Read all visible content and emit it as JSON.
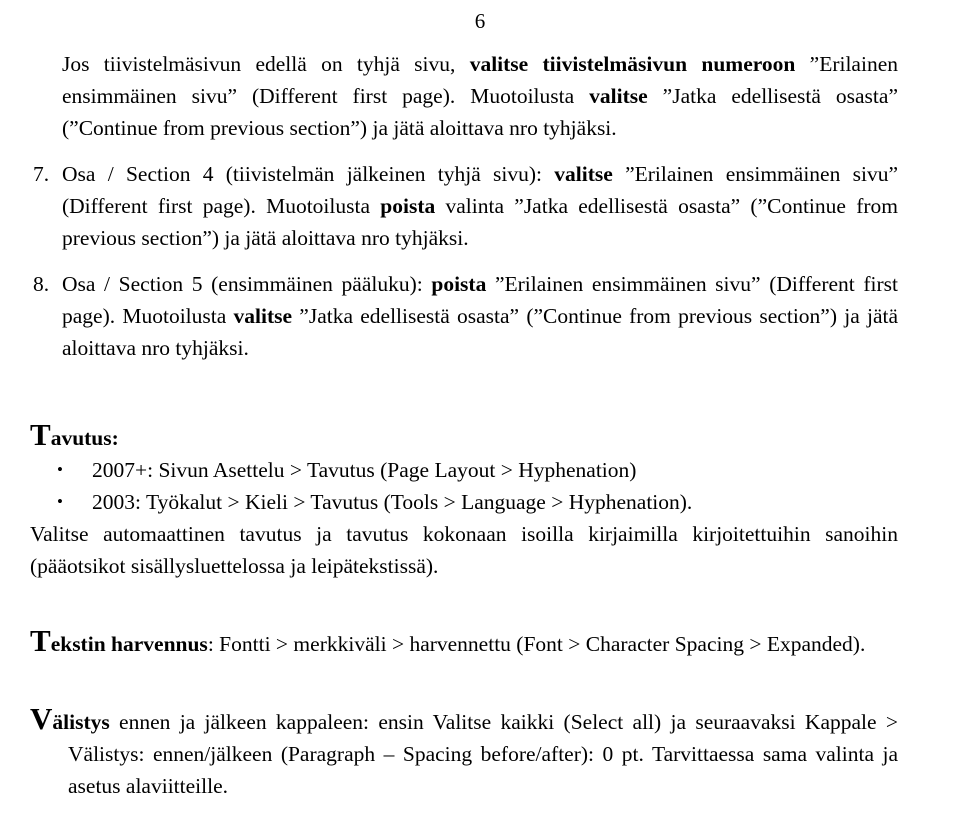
{
  "page": {
    "number": "6",
    "language": "fi",
    "text_color": "#000000",
    "background_color": "#ffffff"
  },
  "body": {
    "item6_continuation": {
      "seg1": "Jos tiivistelmäsivun edellä on tyhjä sivu, ",
      "seg2_bold": "valitse tiivistelmäsivun numeroon",
      "seg3": " ”Erilainen ensimmäinen sivu” (Different first page). Muotoilusta ",
      "seg4_bold": "valitse",
      "seg5": " ”Jatka edellisestä osasta” (”Continue from previous section”) ja jätä aloittava nro tyhjäksi."
    },
    "numbered_items": [
      {
        "marker": "7.",
        "seg1": "Osa / Section 4 (tiivistelmän jälkeinen tyhjä sivu): ",
        "seg2_bold": "valitse",
        "seg3": " ”Erilainen ensimmäinen sivu” (Different first page). Muotoilusta ",
        "seg4_bold": "poista",
        "seg5": " valinta ”Jatka edellisestä osasta” (”Continue from previous section”) ja jätä aloittava nro tyhjäksi."
      },
      {
        "marker": "8.",
        "seg1": "Osa / Section 5 (ensimmäinen pääluku): ",
        "seg2_bold": "poista",
        "seg3": " ”Erilainen ensimmäinen sivu” (Different first page). Muotoilusta ",
        "seg4_bold": "valitse",
        "seg5": " ”Jatka edellisestä osasta” (”Continue from previous section”) ja jätä aloittava nro tyhjäksi."
      }
    ],
    "tavutus": {
      "heading_initial": "T",
      "heading_rest": "avutus",
      "heading_colon": ":",
      "bullets": [
        {
          "glyph": "•",
          "text": "2007+: Sivun Asettelu > Tavutus (Page Layout > Hyphenation)"
        },
        {
          "glyph": "•",
          "text": "2003: Työkalut > Kieli > Tavutus (Tools > Language > Hyphenation)."
        }
      ],
      "paragraph": "Valitse automaattinen tavutus ja tavutus kokonaan isoilla kirjaimilla kirjoitettuihin sanoihin (pääotsikot sisällysluettelossa ja leipätekstissä)."
    },
    "tekstin_harvennus": {
      "heading_initial": "T",
      "heading_rest": "ekstin harvennus",
      "heading_colon": ":",
      "paragraph": " Fontti > merkkiväli > harvennettu (Font > Character Spacing > Expanded)."
    },
    "valistys": {
      "heading_initial": "V",
      "heading_rest": "älistys",
      "paragraph": " ennen ja jälkeen kappaleen: ensin Valitse kaikki (Select all) ja seuraavaksi Kappale > Välistys: ennen/jälkeen (Paragraph – Spacing before/after): 0 pt. Tarvittaessa sama valinta ja asetus alaviitteille."
    }
  }
}
